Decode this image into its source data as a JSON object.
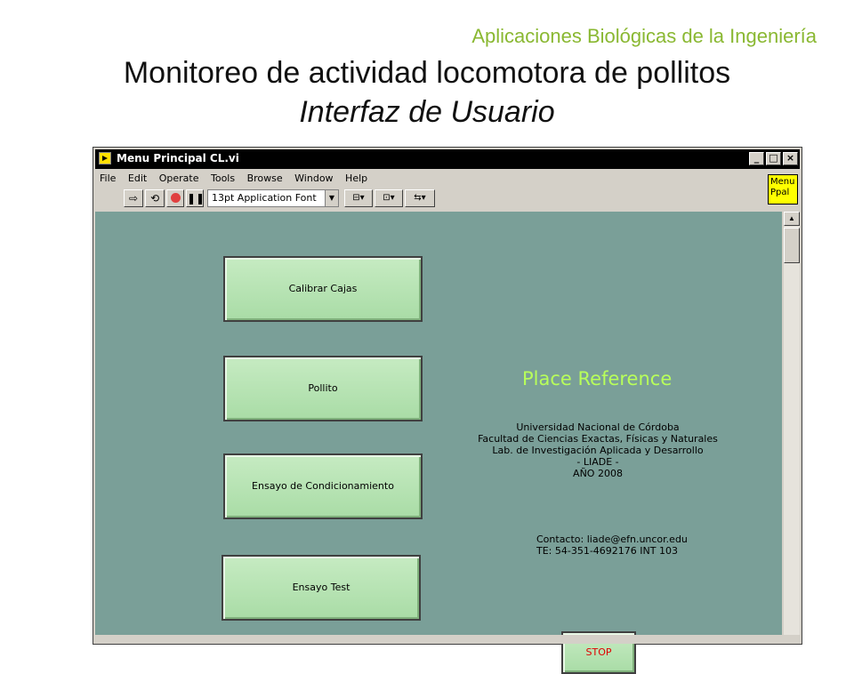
{
  "slide": {
    "top_label": "Aplicaciones Biológicas de la Ingeniería",
    "title_line1": "Monitoreo de actividad locomotora de pollitos",
    "title_line2": "Interfaz de Usuario"
  },
  "window": {
    "title": "Menu Principal CL.vi",
    "controls": {
      "minimize": "_",
      "maximize": "□",
      "close": "×"
    },
    "menu": [
      "File",
      "Edit",
      "Operate",
      "Tools",
      "Browse",
      "Window",
      "Help"
    ],
    "toolbar": {
      "font_select": "13pt Application Font",
      "run_icon": "run-arrow-icon",
      "run_continuous_icon": "run-continuously-icon",
      "abort_icon": "abort-icon",
      "pause_icon": "pause-icon"
    },
    "menu_ppal": "Menu Ppal"
  },
  "panel": {
    "buttons": [
      "Calibrar Cajas",
      "Pollito",
      "Ensayo de Condicionamiento",
      "Ensayo Test"
    ],
    "place_reference": "Place Reference",
    "info_lines": [
      "Universidad Nacional de Córdoba",
      "Facultad de Ciencias Exactas, Físicas y Naturales",
      "Lab. de Investigación Aplicada y Desarrollo",
      "- LIADE -",
      "AÑO 2008"
    ],
    "contact_lines": [
      "Contacto: liade@efn.uncor.edu",
      "TE: 54-351-4692176 INT 103"
    ],
    "stop_label": "STOP",
    "colors": {
      "panel_bg": "#7a9f98",
      "button_bg": "#b8e4b4",
      "place_ref": "#b8ff5a",
      "stop_text": "#e00000"
    }
  }
}
